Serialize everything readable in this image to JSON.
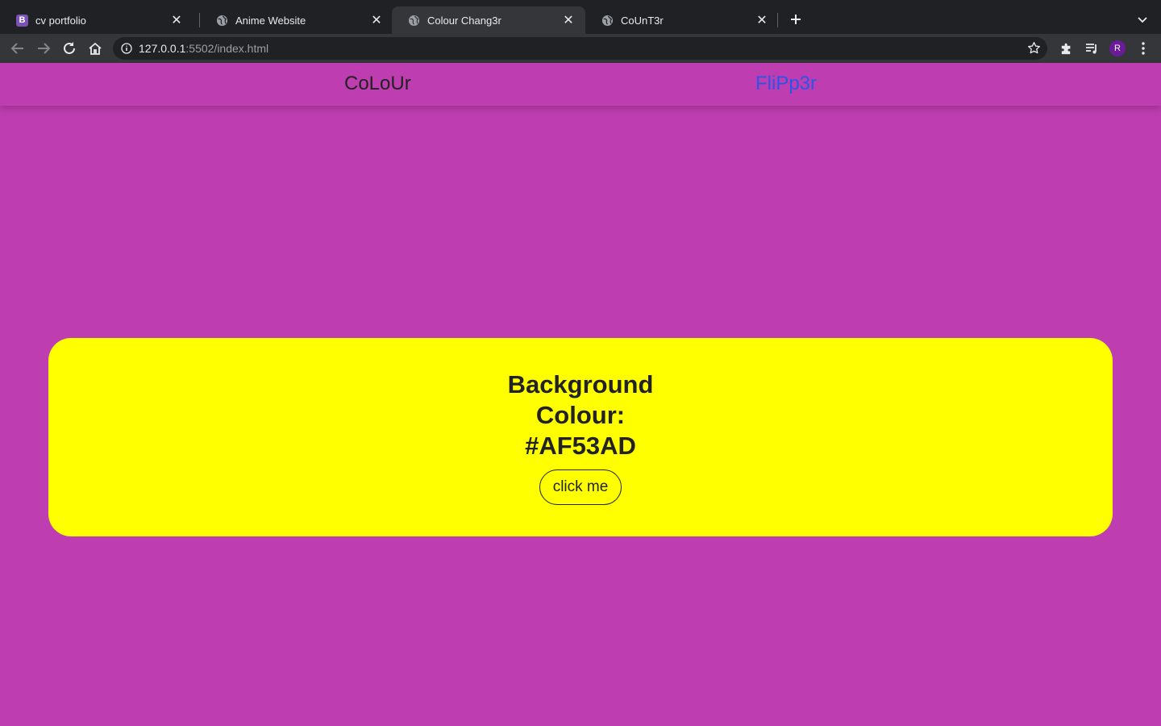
{
  "browser": {
    "tabs": [
      {
        "title": "cv portfolio",
        "favicon": "bootstrap-icon"
      },
      {
        "title": "Anime Website",
        "favicon": "globe-icon"
      },
      {
        "title": "Colour Chang3r",
        "favicon": "globe-icon",
        "active": true
      },
      {
        "title": "CoUnT3r",
        "favicon": "globe-icon"
      }
    ],
    "address": {
      "host": "127.0.0.1",
      "path": ":5502/index.html"
    },
    "profile_initial": "R"
  },
  "nav": {
    "colour_link": "CoLoUr",
    "flipper_link": "FliPp3r"
  },
  "main": {
    "heading": "Background Colour: #AF53AD",
    "button_label": "click me"
  },
  "colors": {
    "page_background": "#BE3DB0",
    "card_background": "#FFFF00",
    "link_active": "#2A55E8"
  }
}
